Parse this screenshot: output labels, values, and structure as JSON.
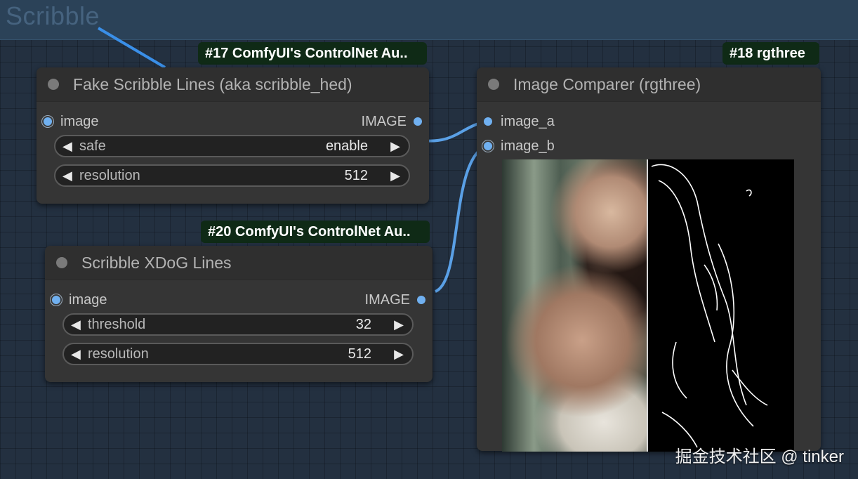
{
  "group": {
    "title": "Scribble"
  },
  "nodes": {
    "fake_scribble": {
      "badge": "#17 ComfyUI's ControlNet Au..",
      "title": "Fake Scribble Lines (aka scribble_hed)",
      "input_label": "image",
      "output_label": "IMAGE",
      "widgets": [
        {
          "label": "safe",
          "value": "enable"
        },
        {
          "label": "resolution",
          "value": "512"
        }
      ]
    },
    "xdog": {
      "badge": "#20 ComfyUI's ControlNet Au..",
      "title": "Scribble XDoG Lines",
      "input_label": "image",
      "output_label": "IMAGE",
      "widgets": [
        {
          "label": "threshold",
          "value": "32"
        },
        {
          "label": "resolution",
          "value": "512"
        }
      ]
    },
    "comparer": {
      "badge": "#18 rgthree",
      "title": "Image Comparer (rgthree)",
      "inputs": [
        "image_a",
        "image_b"
      ]
    }
  },
  "icons": {
    "arrow_left": "◀",
    "arrow_right": "▶"
  },
  "colors": {
    "link": "#5aa0e6",
    "slot": "#70b0f0",
    "badge_bg": "#0f2a16"
  },
  "watermark": "掘金技术社区 @ tinker"
}
